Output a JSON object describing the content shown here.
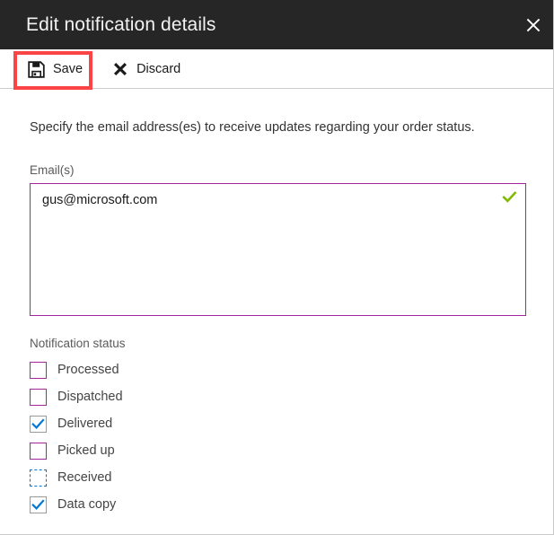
{
  "titlebar": {
    "title": "Edit notification details",
    "close_icon": "close-icon"
  },
  "commandbar": {
    "save": {
      "label": "Save",
      "icon": "save-floppy-disk-icon"
    },
    "discard": {
      "label": "Discard",
      "icon": "close-x-icon"
    }
  },
  "annotation": {
    "highlight_color": "#fa4445",
    "target": "save-button"
  },
  "main": {
    "description": "Specify the email address(es) to receive updates regarding your order status.",
    "email_field": {
      "label": "Email(s)",
      "value": "gus@microsoft.com",
      "placeholder": "",
      "valid": true,
      "valid_icon": "checkmark-icon",
      "border_color": "#a2259b",
      "valid_icon_color": "#7fba00"
    },
    "notification_status": {
      "label": "Notification status",
      "items": [
        {
          "label": "Processed",
          "checked": false,
          "state": "normal"
        },
        {
          "label": "Dispatched",
          "checked": false,
          "state": "normal"
        },
        {
          "label": "Delivered",
          "checked": true,
          "state": "checked"
        },
        {
          "label": "Picked up",
          "checked": false,
          "state": "normal"
        },
        {
          "label": "Received",
          "checked": false,
          "state": "focus"
        },
        {
          "label": "Data copy",
          "checked": true,
          "state": "checked"
        }
      ],
      "unchecked_border_color": "#a2259b",
      "focus_border_color": "#0078d7",
      "checkmark_color": "#0078d7"
    }
  }
}
